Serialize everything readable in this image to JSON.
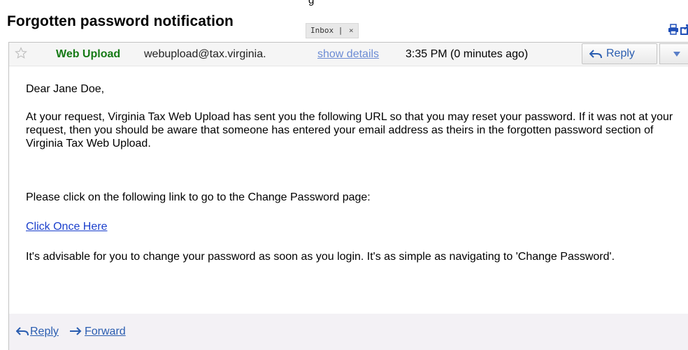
{
  "top_strip_text": "g",
  "subject": "Forgotten password notification",
  "label": {
    "name": "Inbox",
    "separator": "|",
    "remove": "×"
  },
  "message": {
    "sender_name": "Web Upload",
    "sender_email": "webupload@tax.virginia.",
    "show_details": "show details",
    "time": "3:35 PM (0 minutes ago)",
    "reply_label": "Reply",
    "greeting": "Dear Jane Doe,",
    "paragraph1": "At your request, Virginia Tax Web Upload has sent you the following URL so that you may reset your password. If it was not at your request, then you should be aware that someone has entered your email address as theirs in the forgotten password section of Virginia Tax Web Upload.",
    "paragraph2": "Please click on the following link to go to the Change Password page:",
    "link_text": "Click Once Here",
    "paragraph3": "It's advisable for you to change your password as soon as you login. It's as simple as navigating to 'Change Password'."
  },
  "footer": {
    "reply": "Reply",
    "forward": "Forward"
  },
  "colors": {
    "sender": "#157a15",
    "link": "#1a3fcc",
    "action_link": "#2a5db0",
    "details_link": "#6b8bd4"
  },
  "icons": [
    "print-icon",
    "new-window-icon",
    "star-icon",
    "reply-arrow-icon",
    "dropdown-arrow-icon",
    "forward-arrow-icon"
  ]
}
